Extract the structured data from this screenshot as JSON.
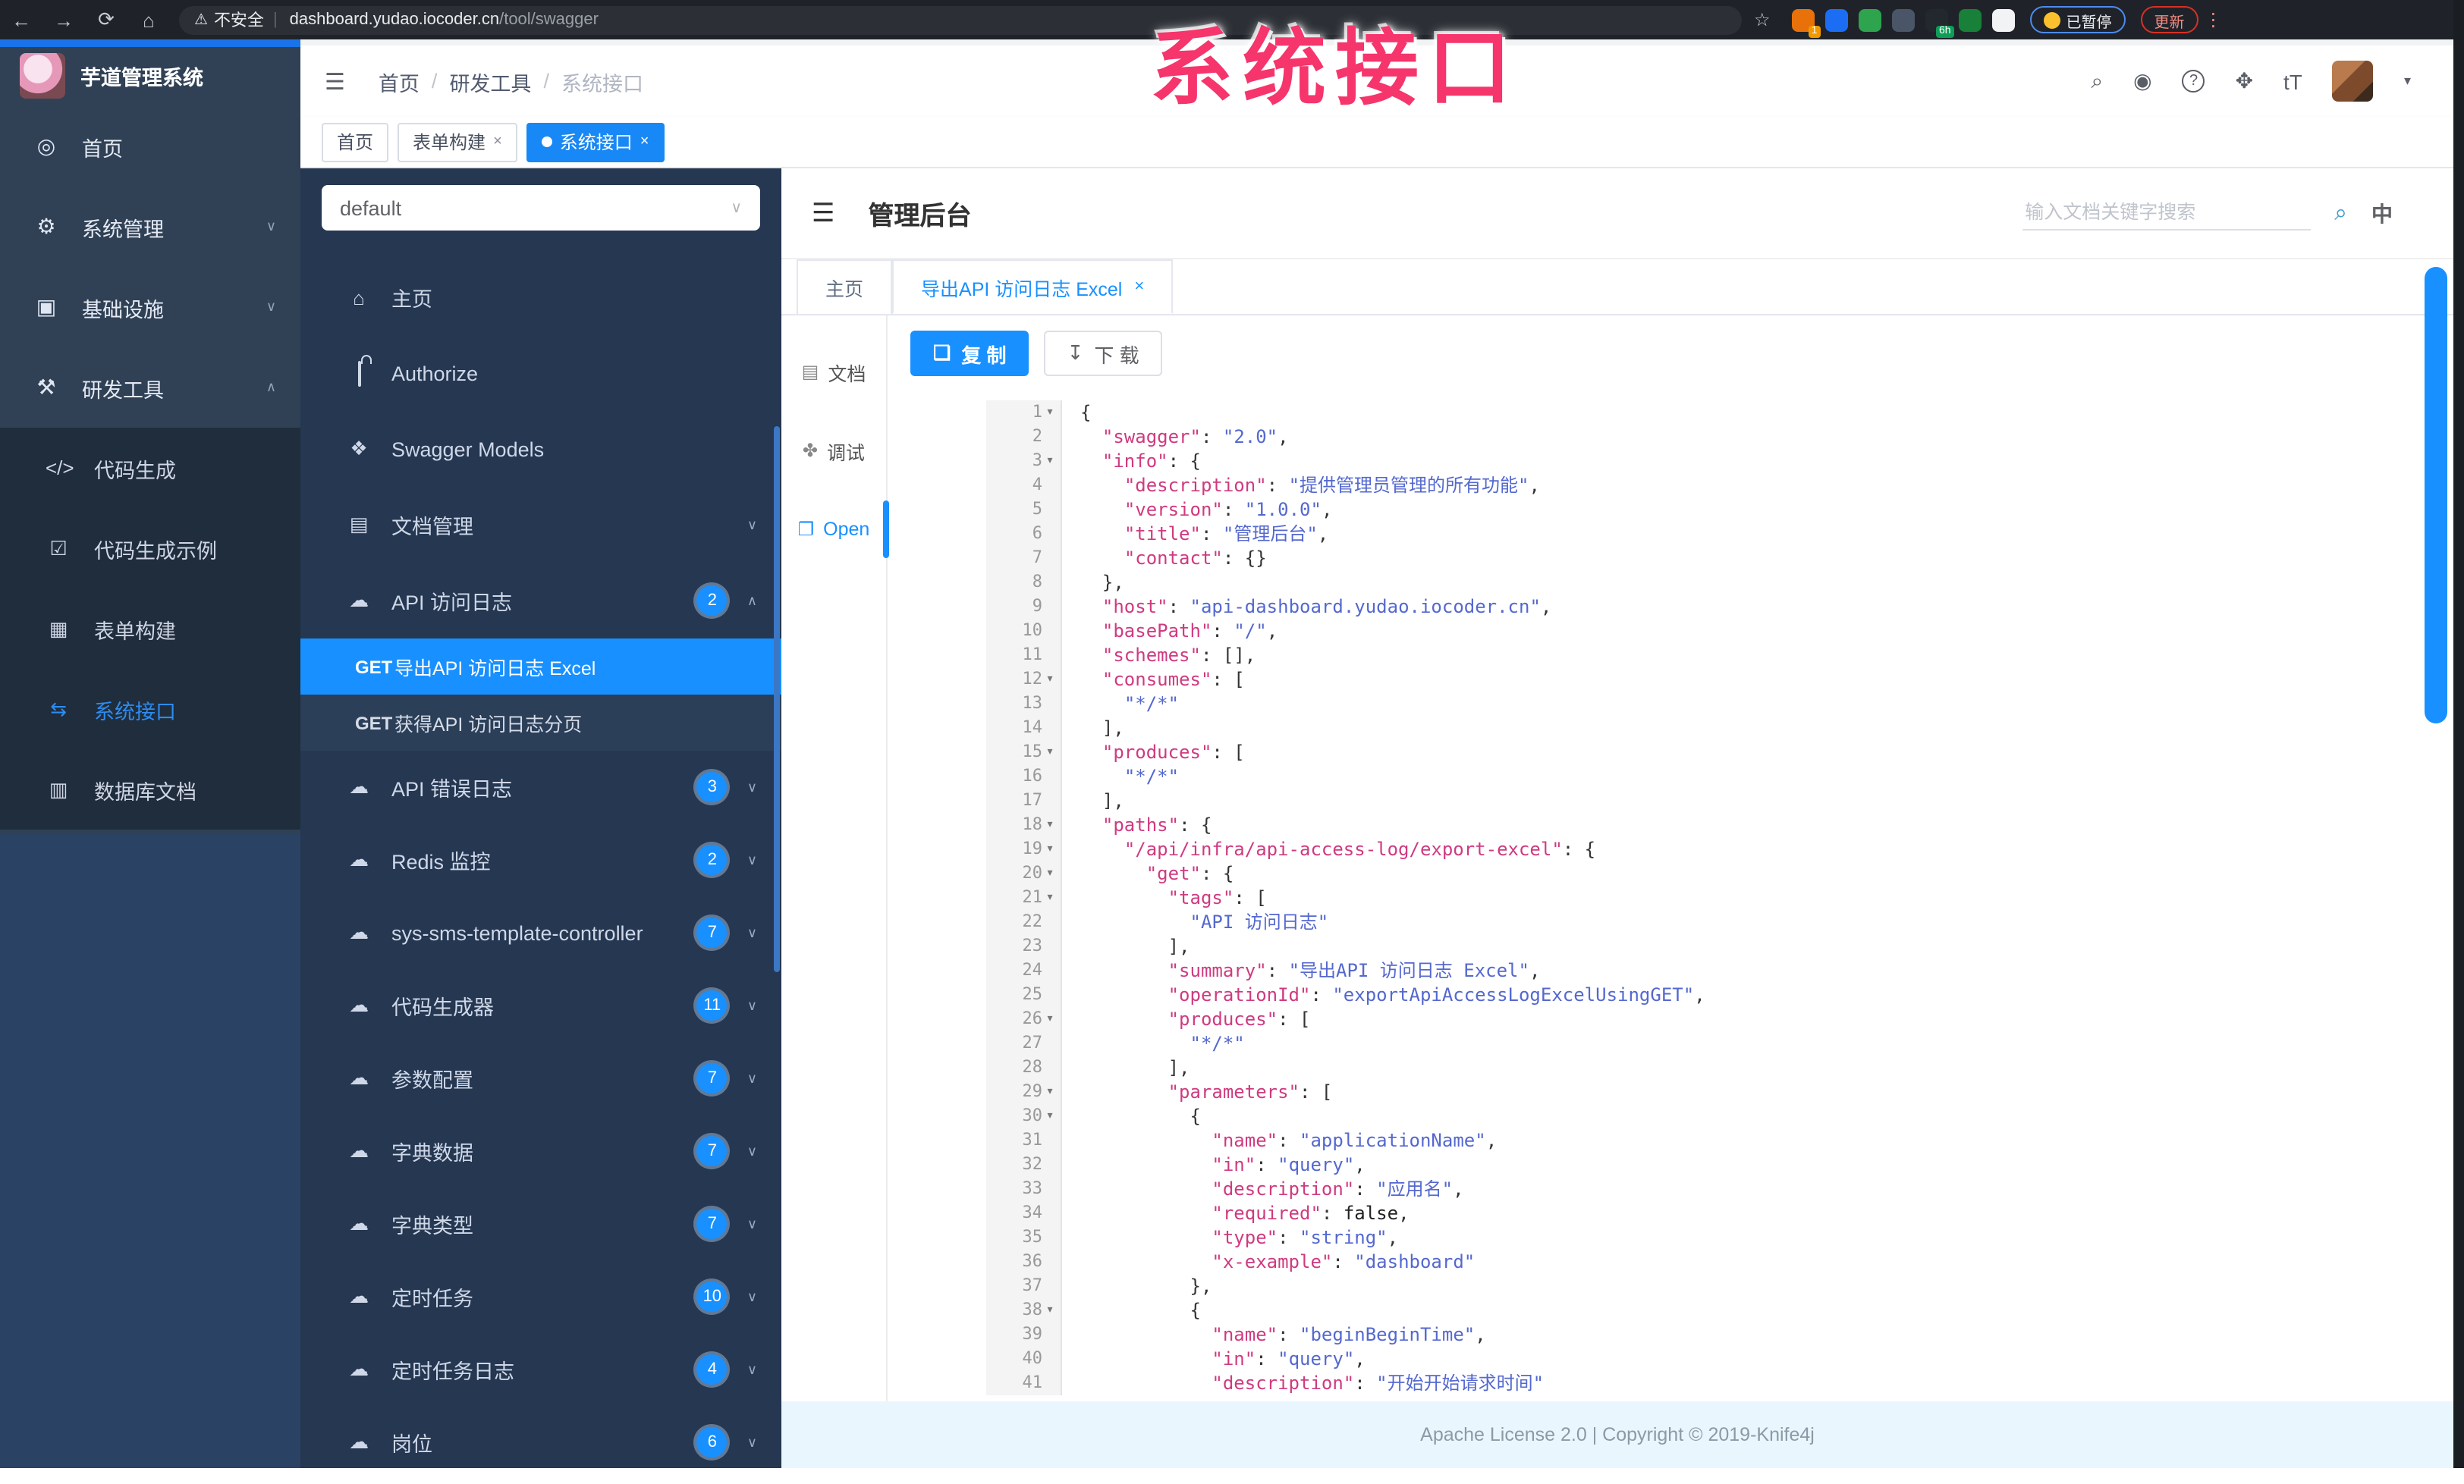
{
  "annotation": {
    "text": "系统接口",
    "color": "#f5356b"
  },
  "browser": {
    "security_label": "不安全",
    "url_host": "dashboard.yudao.iocoder.cn",
    "url_path": "/tool/swagger",
    "profile_badge": "已暂停",
    "update_label": "更新",
    "extensions": [
      {
        "name": "extension-orange",
        "color": "#e8710a",
        "badge": "1",
        "badge_color": "#f29900"
      },
      {
        "name": "extension-pin",
        "color": "#1b6ef3"
      },
      {
        "name": "extension-green-circle",
        "color": "#2ea44f"
      },
      {
        "name": "extension-grid",
        "color": "#4a5568"
      },
      {
        "name": "extension-dark",
        "color": "#23272e",
        "badge": "6h",
        "badge_color": "#0f9d58"
      },
      {
        "name": "extension-leaf",
        "color": "#188038"
      },
      {
        "name": "extension-paw",
        "color": "#f1f3f4"
      }
    ]
  },
  "admin": {
    "app_title": "芋道管理系统",
    "breadcrumb": [
      "首页",
      "研发工具",
      "系统接口"
    ],
    "tags": [
      {
        "label": "首页",
        "closable": false,
        "active": false
      },
      {
        "label": "表单构建",
        "closable": true,
        "active": false
      },
      {
        "label": "系统接口",
        "closable": true,
        "active": true
      }
    ],
    "menu": [
      {
        "label": "首页",
        "icon": "dashboard"
      },
      {
        "label": "系统管理",
        "icon": "gear",
        "arrow": "down"
      },
      {
        "label": "基础设施",
        "icon": "monitor",
        "arrow": "down"
      },
      {
        "label": "研发工具",
        "icon": "tool",
        "arrow": "up"
      }
    ],
    "submenu": [
      {
        "label": "代码生成",
        "icon": "code",
        "active": false
      },
      {
        "label": "代码生成示例",
        "icon": "example",
        "active": false
      },
      {
        "label": "表单构建",
        "icon": "form",
        "active": false
      },
      {
        "label": "系统接口",
        "icon": "api",
        "active": true
      },
      {
        "label": "数据库文档",
        "icon": "db",
        "active": false
      }
    ]
  },
  "swagger": {
    "group_select": "default",
    "menu_top": [
      {
        "label": "主页",
        "icon": "home"
      },
      {
        "label": "Authorize",
        "icon": "lock"
      },
      {
        "label": "Swagger Models",
        "icon": "cube"
      },
      {
        "label": "文档管理",
        "icon": "doc",
        "arrow": "down"
      },
      {
        "label": "API 访问日志",
        "icon": "cloud",
        "badge": "2",
        "arrow": "up"
      }
    ],
    "api_children": [
      {
        "method": "GET",
        "label": "导出API 访问日志 Excel",
        "active": true
      },
      {
        "method": "GET",
        "label": "获得API 访问日志分页",
        "active": false
      }
    ],
    "menu_rest": [
      {
        "label": "API 错误日志",
        "badge": "3"
      },
      {
        "label": "Redis 监控",
        "badge": "2"
      },
      {
        "label": "sys-sms-template-controller",
        "badge": "7"
      },
      {
        "label": "代码生成器",
        "badge": "11"
      },
      {
        "label": "参数配置",
        "badge": "7"
      },
      {
        "label": "字典数据",
        "badge": "7"
      },
      {
        "label": "字典类型",
        "badge": "7"
      },
      {
        "label": "定时任务",
        "badge": "10"
      },
      {
        "label": "定时任务日志",
        "badge": "4"
      },
      {
        "label": "岗位",
        "badge": "6"
      }
    ],
    "doc_header": {
      "title": "管理后台",
      "search_placeholder": "输入文档关键字搜索"
    },
    "doc_tabs": [
      {
        "label": "主页",
        "active": false,
        "closable": false
      },
      {
        "label": "导出API 访问日志 Excel",
        "active": true,
        "closable": true
      }
    ],
    "side_tabs": [
      {
        "label": "文档",
        "icon": "doc2",
        "active": false
      },
      {
        "label": "调试",
        "icon": "bug",
        "active": false
      },
      {
        "label": "Open",
        "icon": "file",
        "active": true
      }
    ],
    "buttons": {
      "copy": "复 制",
      "download": "下 载"
    },
    "footer": "Apache License 2.0 | Copyright © 2019-Knife4j"
  },
  "icons": {
    "dashboard": "◎",
    "gear": "⚙",
    "monitor": "▣",
    "tool": "⚒",
    "code": "</>",
    "example": "☑",
    "form": "▦",
    "api": "⇆",
    "db": "▥",
    "home": "⌂",
    "cube": "❖",
    "doc": "▤",
    "cloud": "☁",
    "doc2": "▤",
    "bug": "✤",
    "file": "❐",
    "copy": "❏",
    "download": "↧",
    "search": "⌕",
    "github": "◉",
    "fullscreen": "✥",
    "font": "tT",
    "chevron_down": "∨",
    "chevron_up": "∧",
    "caret": "▾",
    "back": "←",
    "forward": "→",
    "reload": "⟳",
    "homebtn": "⌂",
    "warn": "⚠",
    "star": "☆",
    "dots": "⋮",
    "lang": "中",
    "collapse": "☰",
    "paw": "✽",
    "fold": "▾",
    "help": "?"
  },
  "code": {
    "lines": [
      {
        "n": 1,
        "f": 1,
        "parts": [
          [
            "p",
            "{"
          ]
        ]
      },
      {
        "n": 2,
        "parts": [
          [
            "p",
            "  "
          ],
          [
            "k",
            "\"swagger\""
          ],
          [
            "p",
            ": "
          ],
          [
            "v",
            "\"2.0\""
          ],
          [
            "p",
            ","
          ]
        ]
      },
      {
        "n": 3,
        "f": 1,
        "parts": [
          [
            "p",
            "  "
          ],
          [
            "k",
            "\"info\""
          ],
          [
            "p",
            ": {"
          ]
        ]
      },
      {
        "n": 4,
        "parts": [
          [
            "p",
            "    "
          ],
          [
            "k",
            "\"description\""
          ],
          [
            "p",
            ": "
          ],
          [
            "v",
            "\"提供管理员管理的所有功能\""
          ],
          [
            "p",
            ","
          ]
        ]
      },
      {
        "n": 5,
        "parts": [
          [
            "p",
            "    "
          ],
          [
            "k",
            "\"version\""
          ],
          [
            "p",
            ": "
          ],
          [
            "v",
            "\"1.0.0\""
          ],
          [
            "p",
            ","
          ]
        ]
      },
      {
        "n": 6,
        "parts": [
          [
            "p",
            "    "
          ],
          [
            "k",
            "\"title\""
          ],
          [
            "p",
            ": "
          ],
          [
            "v",
            "\"管理后台\""
          ],
          [
            "p",
            ","
          ]
        ]
      },
      {
        "n": 7,
        "parts": [
          [
            "p",
            "    "
          ],
          [
            "k",
            "\"contact\""
          ],
          [
            "p",
            ": {}"
          ]
        ]
      },
      {
        "n": 8,
        "parts": [
          [
            "p",
            "  },"
          ]
        ]
      },
      {
        "n": 9,
        "parts": [
          [
            "p",
            "  "
          ],
          [
            "k",
            "\"host\""
          ],
          [
            "p",
            ": "
          ],
          [
            "v",
            "\"api-dashboard.yudao.iocoder.cn\""
          ],
          [
            "p",
            ","
          ]
        ]
      },
      {
        "n": 10,
        "parts": [
          [
            "p",
            "  "
          ],
          [
            "k",
            "\"basePath\""
          ],
          [
            "p",
            ": "
          ],
          [
            "v",
            "\"/\""
          ],
          [
            "p",
            ","
          ]
        ]
      },
      {
        "n": 11,
        "parts": [
          [
            "p",
            "  "
          ],
          [
            "k",
            "\"schemes\""
          ],
          [
            "p",
            ": [],"
          ]
        ]
      },
      {
        "n": 12,
        "f": 1,
        "parts": [
          [
            "p",
            "  "
          ],
          [
            "k",
            "\"consumes\""
          ],
          [
            "p",
            ": ["
          ]
        ]
      },
      {
        "n": 13,
        "parts": [
          [
            "p",
            "    "
          ],
          [
            "v",
            "\"*/*\""
          ]
        ]
      },
      {
        "n": 14,
        "parts": [
          [
            "p",
            "  ],"
          ]
        ]
      },
      {
        "n": 15,
        "f": 1,
        "parts": [
          [
            "p",
            "  "
          ],
          [
            "k",
            "\"produces\""
          ],
          [
            "p",
            ": ["
          ]
        ]
      },
      {
        "n": 16,
        "parts": [
          [
            "p",
            "    "
          ],
          [
            "v",
            "\"*/*\""
          ]
        ]
      },
      {
        "n": 17,
        "parts": [
          [
            "p",
            "  ],"
          ]
        ]
      },
      {
        "n": 18,
        "f": 1,
        "parts": [
          [
            "p",
            "  "
          ],
          [
            "k",
            "\"paths\""
          ],
          [
            "p",
            ": {"
          ]
        ]
      },
      {
        "n": 19,
        "f": 1,
        "parts": [
          [
            "p",
            "    "
          ],
          [
            "k",
            "\"/api/infra/api-access-log/export-excel\""
          ],
          [
            "p",
            ": {"
          ]
        ]
      },
      {
        "n": 20,
        "f": 1,
        "parts": [
          [
            "p",
            "      "
          ],
          [
            "k",
            "\"get\""
          ],
          [
            "p",
            ": {"
          ]
        ]
      },
      {
        "n": 21,
        "f": 1,
        "parts": [
          [
            "p",
            "        "
          ],
          [
            "k",
            "\"tags\""
          ],
          [
            "p",
            ": ["
          ]
        ]
      },
      {
        "n": 22,
        "parts": [
          [
            "p",
            "          "
          ],
          [
            "v",
            "\"API 访问日志\""
          ]
        ]
      },
      {
        "n": 23,
        "parts": [
          [
            "p",
            "        ],"
          ]
        ]
      },
      {
        "n": 24,
        "parts": [
          [
            "p",
            "        "
          ],
          [
            "k",
            "\"summary\""
          ],
          [
            "p",
            ": "
          ],
          [
            "v",
            "\"导出API 访问日志 Excel\""
          ],
          [
            "p",
            ","
          ]
        ]
      },
      {
        "n": 25,
        "parts": [
          [
            "p",
            "        "
          ],
          [
            "k",
            "\"operationId\""
          ],
          [
            "p",
            ": "
          ],
          [
            "v",
            "\"exportApiAccessLogExcelUsingGET\""
          ],
          [
            "p",
            ","
          ]
        ]
      },
      {
        "n": 26,
        "f": 1,
        "parts": [
          [
            "p",
            "        "
          ],
          [
            "k",
            "\"produces\""
          ],
          [
            "p",
            ": ["
          ]
        ]
      },
      {
        "n": 27,
        "parts": [
          [
            "p",
            "          "
          ],
          [
            "v",
            "\"*/*\""
          ]
        ]
      },
      {
        "n": 28,
        "parts": [
          [
            "p",
            "        ],"
          ]
        ]
      },
      {
        "n": 29,
        "f": 1,
        "parts": [
          [
            "p",
            "        "
          ],
          [
            "k",
            "\"parameters\""
          ],
          [
            "p",
            ": ["
          ]
        ]
      },
      {
        "n": 30,
        "f": 1,
        "parts": [
          [
            "p",
            "          {"
          ]
        ]
      },
      {
        "n": 31,
        "parts": [
          [
            "p",
            "            "
          ],
          [
            "k",
            "\"name\""
          ],
          [
            "p",
            ": "
          ],
          [
            "v",
            "\"applicationName\""
          ],
          [
            "p",
            ","
          ]
        ]
      },
      {
        "n": 32,
        "parts": [
          [
            "p",
            "            "
          ],
          [
            "k",
            "\"in\""
          ],
          [
            "p",
            ": "
          ],
          [
            "v",
            "\"query\""
          ],
          [
            "p",
            ","
          ]
        ]
      },
      {
        "n": 33,
        "parts": [
          [
            "p",
            "            "
          ],
          [
            "k",
            "\"description\""
          ],
          [
            "p",
            ": "
          ],
          [
            "v",
            "\"应用名\""
          ],
          [
            "p",
            ","
          ]
        ]
      },
      {
        "n": 34,
        "parts": [
          [
            "p",
            "            "
          ],
          [
            "k",
            "\"required\""
          ],
          [
            "p",
            ": "
          ],
          [
            "b",
            "false"
          ],
          [
            "p",
            ","
          ]
        ]
      },
      {
        "n": 35,
        "parts": [
          [
            "p",
            "            "
          ],
          [
            "k",
            "\"type\""
          ],
          [
            "p",
            ": "
          ],
          [
            "v",
            "\"string\""
          ],
          [
            "p",
            ","
          ]
        ]
      },
      {
        "n": 36,
        "parts": [
          [
            "p",
            "            "
          ],
          [
            "k",
            "\"x-example\""
          ],
          [
            "p",
            ": "
          ],
          [
            "v",
            "\"dashboard\""
          ]
        ]
      },
      {
        "n": 37,
        "parts": [
          [
            "p",
            "          },"
          ]
        ]
      },
      {
        "n": 38,
        "f": 1,
        "parts": [
          [
            "p",
            "          {"
          ]
        ]
      },
      {
        "n": 39,
        "parts": [
          [
            "p",
            "            "
          ],
          [
            "k",
            "\"name\""
          ],
          [
            "p",
            ": "
          ],
          [
            "v",
            "\"beginBeginTime\""
          ],
          [
            "p",
            ","
          ]
        ]
      },
      {
        "n": 40,
        "parts": [
          [
            "p",
            "            "
          ],
          [
            "k",
            "\"in\""
          ],
          [
            "p",
            ": "
          ],
          [
            "v",
            "\"query\""
          ],
          [
            "p",
            ","
          ]
        ]
      },
      {
        "n": 41,
        "parts": [
          [
            "p",
            "            "
          ],
          [
            "k",
            "\"description\""
          ],
          [
            "p",
            ": "
          ],
          [
            "v",
            "\"开始开始请求时间\""
          ]
        ]
      }
    ]
  }
}
